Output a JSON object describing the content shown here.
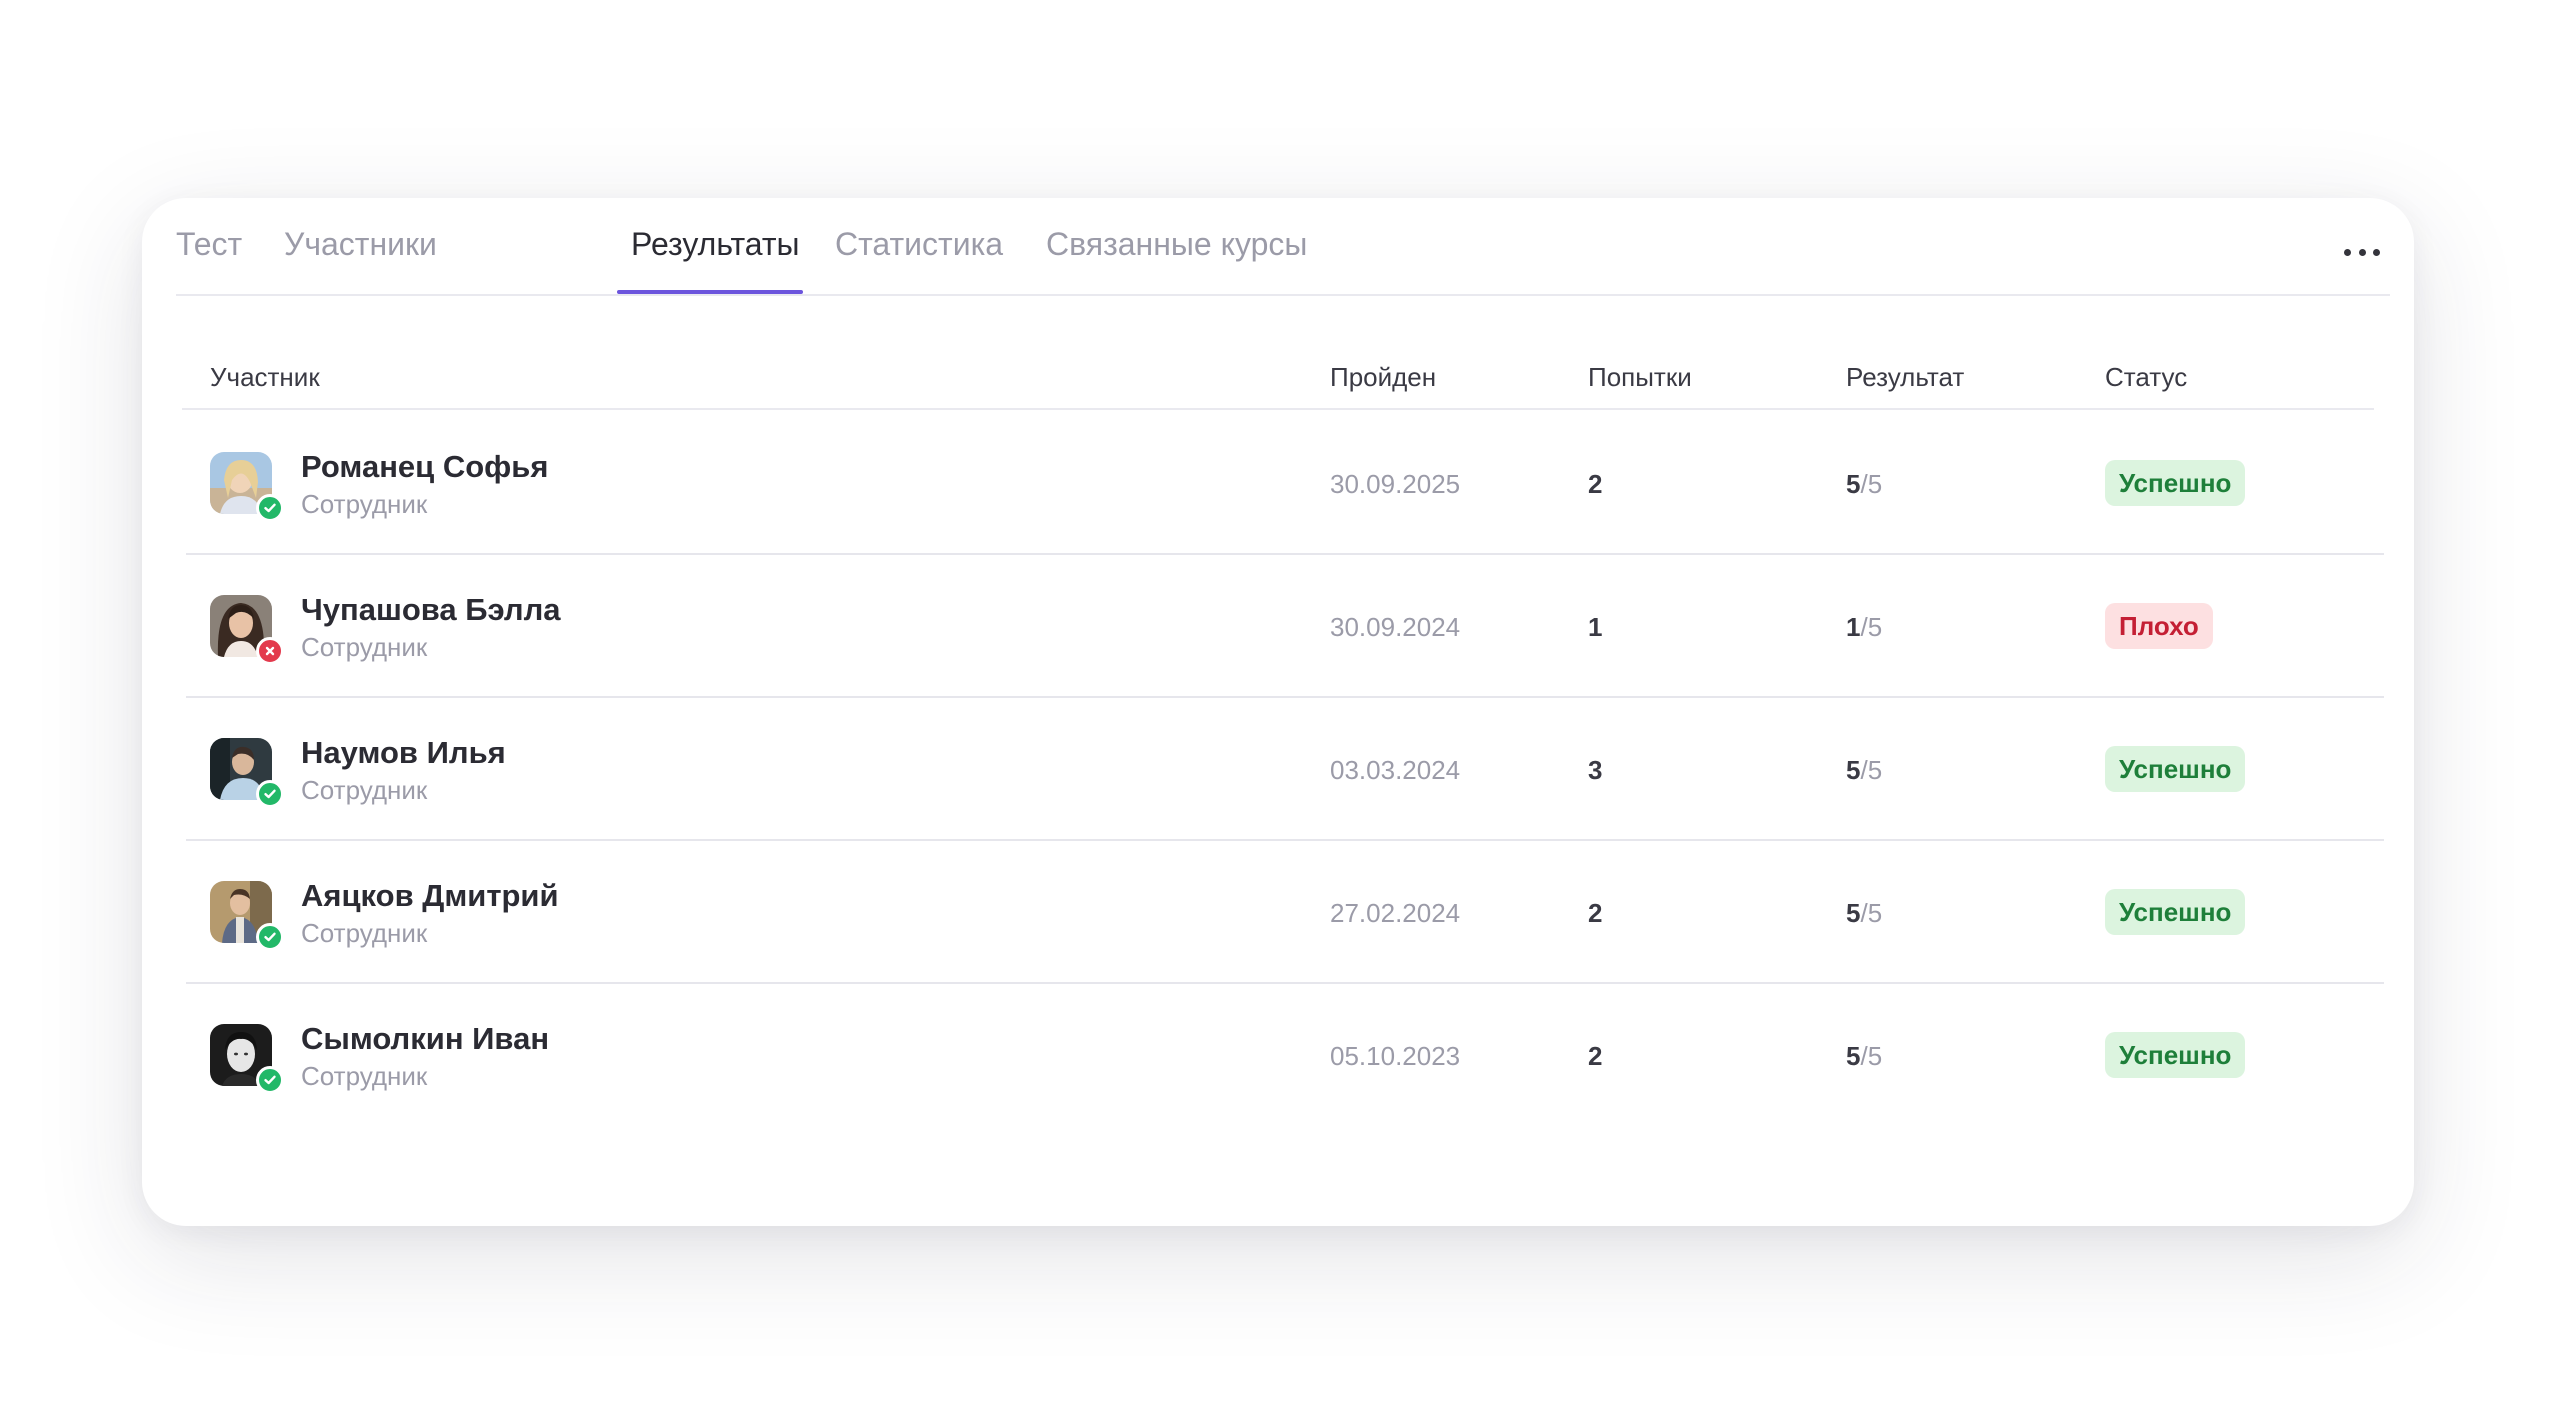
{
  "tabs": [
    {
      "label": "Тест",
      "active": false
    },
    {
      "label": "Участники",
      "active": false
    },
    {
      "label": "Результаты",
      "active": true
    },
    {
      "label": "Статистика",
      "active": false
    },
    {
      "label": "Связанные курсы",
      "active": false
    }
  ],
  "more_icon": "more-horizontal-icon",
  "table": {
    "columns": [
      "Участник",
      "Пройден",
      "Попытки",
      "Результат",
      "Статус"
    ],
    "rows": [
      {
        "name": "Романец Софья",
        "role": "Сотрудник",
        "date": "30.09.2025",
        "attempts": "2",
        "score": "5",
        "total": "/5",
        "status": "Успешно",
        "status_type": "success",
        "badge": "check-icon"
      },
      {
        "name": "Чупашова Бэлла",
        "role": "Сотрудник",
        "date": "30.09.2024",
        "attempts": "1",
        "score": "1",
        "total": "/5",
        "status": "Плохо",
        "status_type": "fail",
        "badge": "cross-icon"
      },
      {
        "name": "Наумов Илья",
        "role": "Сотрудник",
        "date": "03.03.2024",
        "attempts": "3",
        "score": "5",
        "total": "/5",
        "status": "Успешно",
        "status_type": "success",
        "badge": "check-icon"
      },
      {
        "name": "Аяцков Дмитрий",
        "role": "Сотрудник",
        "date": "27.02.2024",
        "attempts": "2",
        "score": "5",
        "total": "/5",
        "status": "Успешно",
        "status_type": "success",
        "badge": "check-icon"
      },
      {
        "name": "Сымолкин Иван",
        "role": "Сотрудник",
        "date": "05.10.2023",
        "attempts": "2",
        "score": "5",
        "total": "/5",
        "status": "Успешно",
        "status_type": "success",
        "badge": "check-icon"
      }
    ]
  },
  "colors": {
    "accent": "#6c55dd",
    "success_bg": "#dcf4df",
    "success_text": "#1e7f3a",
    "fail_bg": "#fde0e1",
    "fail_text": "#c41f34",
    "badge_success": "#22b868",
    "badge_fail": "#e33a4d"
  }
}
